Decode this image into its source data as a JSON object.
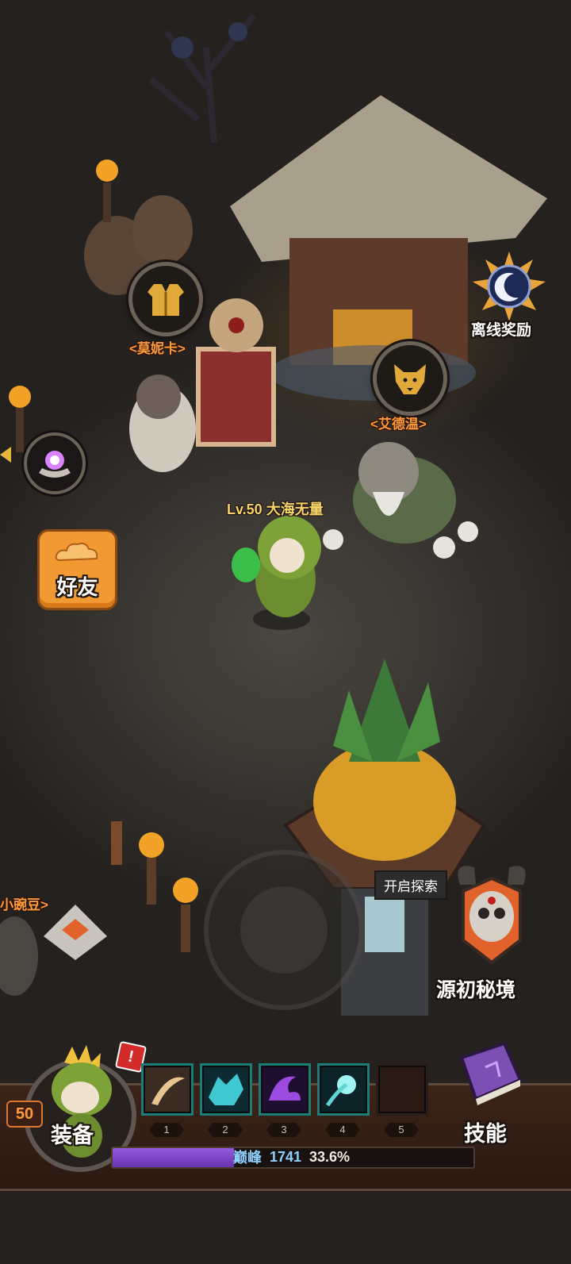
{
  "npcs": {
    "monica": {
      "name": "<莫妮卡>",
      "icon": "robe-icon"
    },
    "edwin": {
      "name": "<艾德温>",
      "icon": "dog-icon"
    },
    "pea": {
      "name": "小豌豆>"
    }
  },
  "player": {
    "level_name": "Lv.50 大海无量"
  },
  "buttons": {
    "offline_reward": "离线奖励",
    "friends": "好友",
    "explore": "开启探索",
    "secret_realm": "源初秘境",
    "equipment": "装备",
    "skills": "技能"
  },
  "hud": {
    "level": "50",
    "skill_slots": [
      "1",
      "2",
      "3",
      "4",
      "5"
    ],
    "peak_label": "巅峰",
    "peak_value": "1741",
    "progress_text": "33.6%",
    "progress": 0.336
  },
  "colors": {
    "npc_name": "#ff9a3c",
    "player_name": "#f7d46a",
    "progress_fill": "#7a3fc4",
    "friend_button": "#f19a34"
  }
}
